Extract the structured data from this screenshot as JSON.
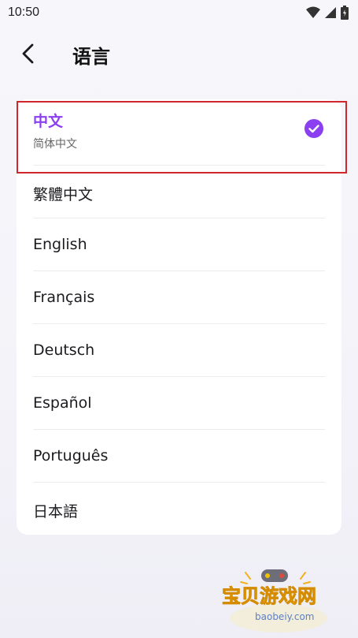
{
  "status_bar": {
    "time": "10:50"
  },
  "header": {
    "title": "语言"
  },
  "selected": {
    "label": "中文",
    "sublabel": "简体中文"
  },
  "languages": [
    {
      "label": "繁體中文"
    },
    {
      "label": "English"
    },
    {
      "label": "Français"
    },
    {
      "label": "Deutsch"
    },
    {
      "label": "Español"
    },
    {
      "label": "Português"
    },
    {
      "label": "日本語"
    }
  ],
  "watermark": {
    "brand": "宝贝游戏网",
    "domain": "baobeiy.com"
  },
  "colors": {
    "accent": "#8a3ff0",
    "highlight": "#d1262b"
  },
  "icons": [
    "back-arrow-icon",
    "check-circle-icon",
    "wifi-icon",
    "signal-icon",
    "battery-icon"
  ]
}
